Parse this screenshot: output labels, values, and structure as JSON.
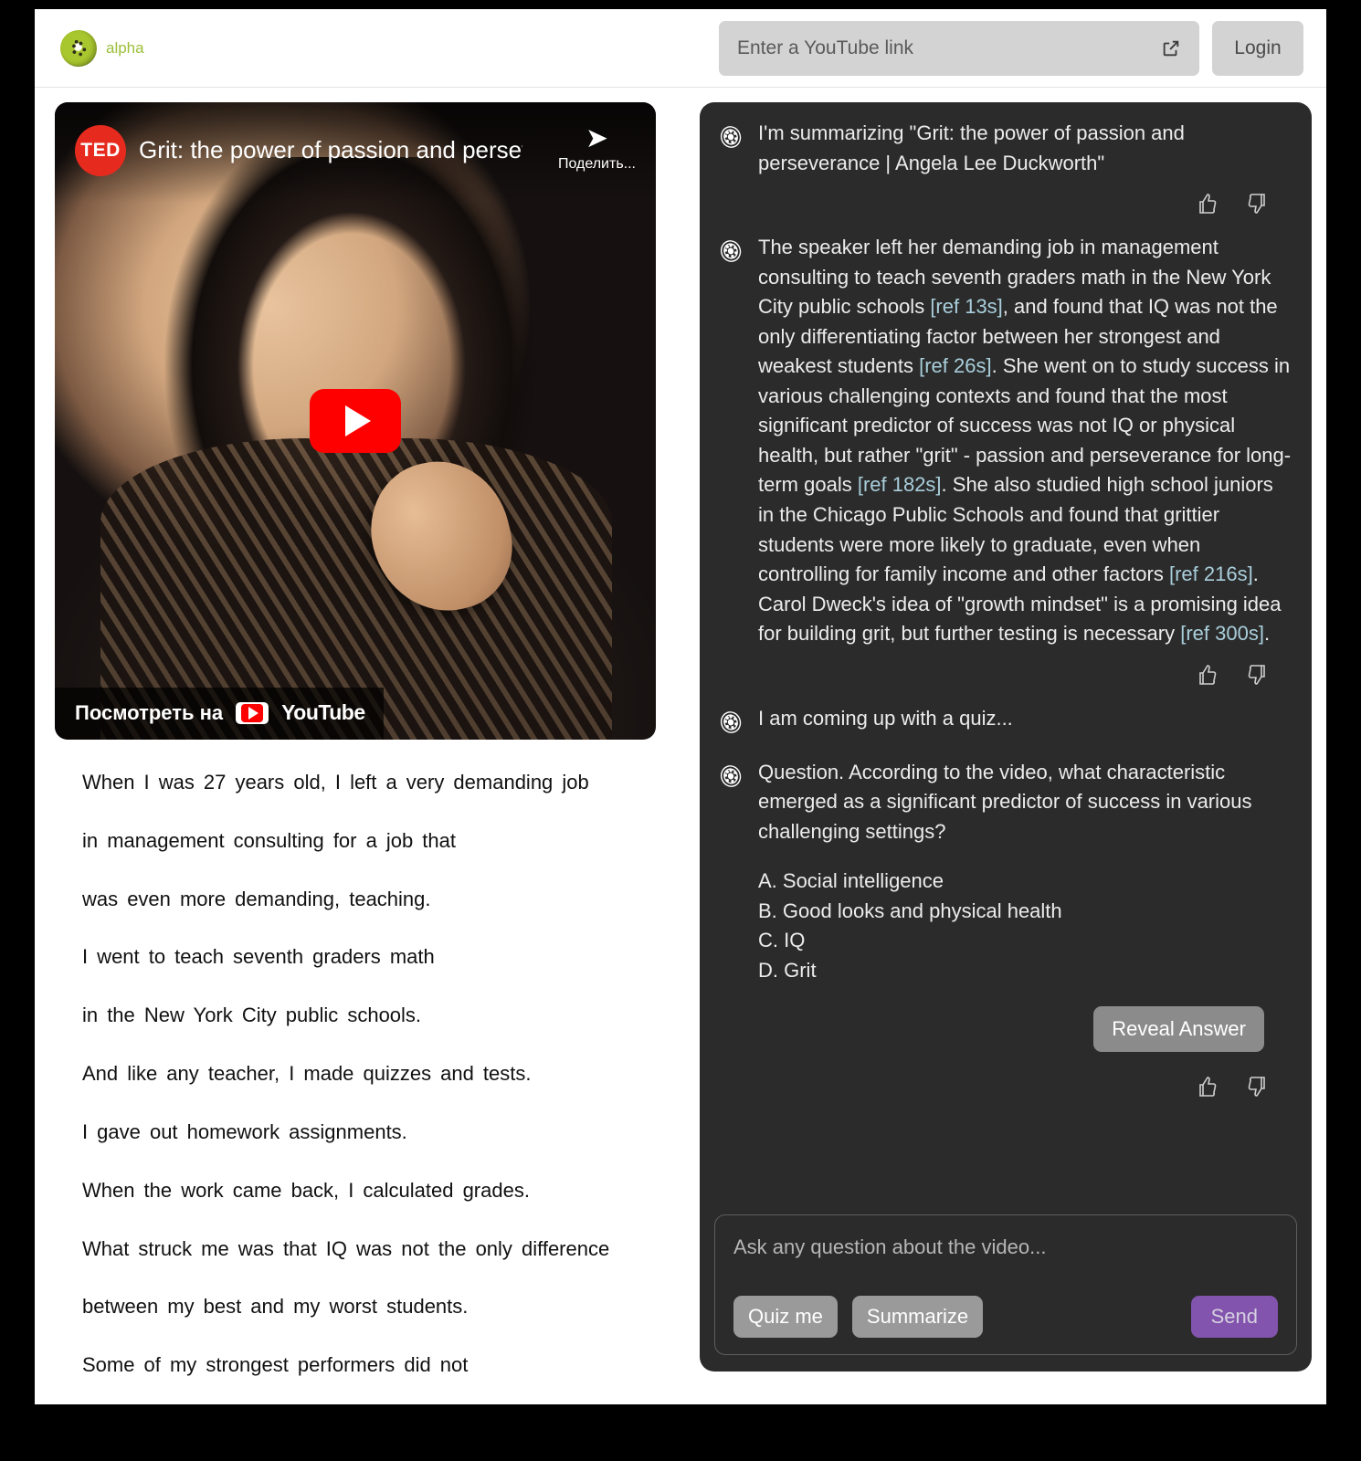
{
  "header": {
    "brand_name": "alpha",
    "logo_icon": "kiwi-icon",
    "url_placeholder": "Enter a YouTube link",
    "external_link_icon": "external-link-icon",
    "login_label": "Login"
  },
  "video": {
    "channel_badge": "TED",
    "title": "Grit: the power of passion and persever...",
    "share_icon": "share-arrow-icon",
    "share_label": "Поделить...",
    "play_icon": "play-icon",
    "watch_on_label": "Посмотреть на",
    "youtube_wordmark": "YouTube"
  },
  "transcript": {
    "lines": [
      "When I was 27 years old, I left a very demanding job",
      "in management consulting for a job that",
      "was even more demanding, teaching.",
      "I went to teach seventh graders math",
      "in the New York City public schools.",
      "And like any teacher, I made quizzes and tests.",
      "I gave out homework assignments.",
      "When the work came back, I calculated grades.",
      "What struck me was that IQ was not the only difference",
      "between my best and my worst students.",
      "Some of my strongest performers did not"
    ]
  },
  "chat": {
    "avatar_icon": "kiwi-slice-icon",
    "thumbs_up_icon": "thumbs-up-icon",
    "thumbs_down_icon": "thumbs-down-icon",
    "messages": {
      "summarizing": "I'm summarizing \"Grit: the power of passion and perseverance | Angela Lee Duckworth\"",
      "summary_parts": {
        "p1": "The speaker left her demanding job in management consulting to teach seventh graders math in the New York City public schools ",
        "ref1": "[ref 13s]",
        "p2": ", and found that IQ was not the only differentiating factor between her strongest and weakest students ",
        "ref2": "[ref 26s]",
        "p3": ". She went on to study success in various challenging contexts and found that the most significant predictor of success was not IQ or physical health, but rather \"grit\" - passion and perseverance for long-term goals ",
        "ref3": "[ref 182s]",
        "p4": ". She also studied high school juniors in the Chicago Public Schools and found that grittier students were more likely to graduate, even when controlling for family income and other factors ",
        "ref4": "[ref 216s]",
        "p5": ". Carol Dweck's idea of \"growth mindset\" is a promising idea for building grit, but further testing is necessary ",
        "ref5": "[ref 300s]",
        "p6": "."
      },
      "coming_up": "I am coming up with a quiz...",
      "question": "Question. According to the video, what characteristic emerged as a significant predictor of success in various challenging settings?",
      "options": [
        "A. Social intelligence",
        "B. Good looks and physical health",
        "C. IQ",
        "D. Grit"
      ],
      "reveal_label": "Reveal Answer"
    },
    "composer": {
      "placeholder": "Ask any question about the video...",
      "quiz_label": "Quiz me",
      "summarize_label": "Summarize",
      "send_label": "Send"
    }
  },
  "colors": {
    "brand_green": "#9cbf3b",
    "chat_bg": "#2b2b2b",
    "ref_link": "#a9cfdc",
    "send_purple": "#8254ad",
    "youtube_red": "#ff0000"
  }
}
